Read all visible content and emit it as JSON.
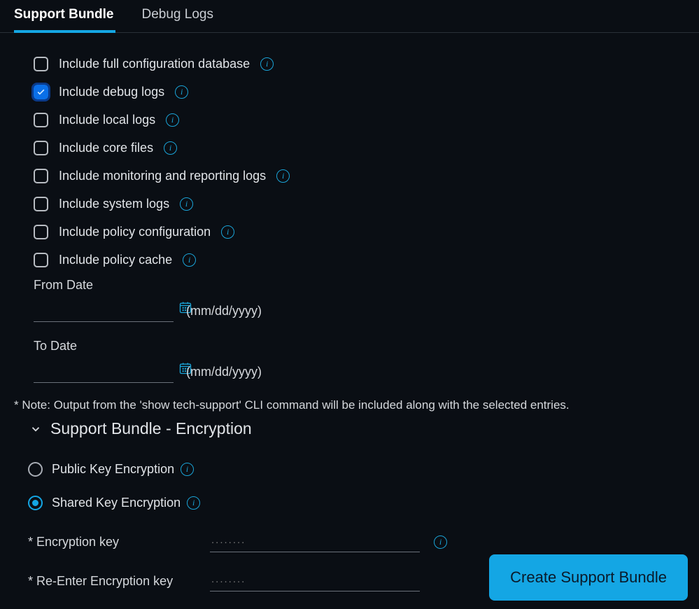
{
  "tabs": {
    "support_bundle": "Support Bundle",
    "debug_logs": "Debug Logs",
    "active_index": 0
  },
  "checkboxes": [
    {
      "label": "Include full configuration database",
      "checked": false
    },
    {
      "label": "Include debug logs",
      "checked": true
    },
    {
      "label": "Include local logs",
      "checked": false
    },
    {
      "label": "Include core files",
      "checked": false
    },
    {
      "label": "Include monitoring and reporting logs",
      "checked": false
    },
    {
      "label": "Include system logs",
      "checked": false
    },
    {
      "label": "Include policy configuration",
      "checked": false
    },
    {
      "label": "Include policy cache",
      "checked": false
    }
  ],
  "date": {
    "from_label": "From Date",
    "to_label": "To Date",
    "from_value": "",
    "to_value": "",
    "format_hint": "(mm/dd/yyyy)"
  },
  "note": "* Note: Output from the 'show tech-support' CLI command will be included along with the selected entries.",
  "encryption_section": {
    "title": "Support Bundle - Encryption",
    "options": [
      {
        "label": "Public Key Encryption",
        "selected": false
      },
      {
        "label": "Shared Key Encryption",
        "selected": true
      }
    ],
    "encryption_key_label": "* Encryption key",
    "reenter_key_label": "* Re-Enter Encryption key",
    "encryption_key_value": "",
    "reenter_key_value": "",
    "key_placeholder": "........"
  },
  "buttons": {
    "create": "Create Support Bundle"
  },
  "colors": {
    "accent": "#14a6e4",
    "bg": "#0a0e14",
    "checkbox_checked": "#0a6fe8"
  }
}
